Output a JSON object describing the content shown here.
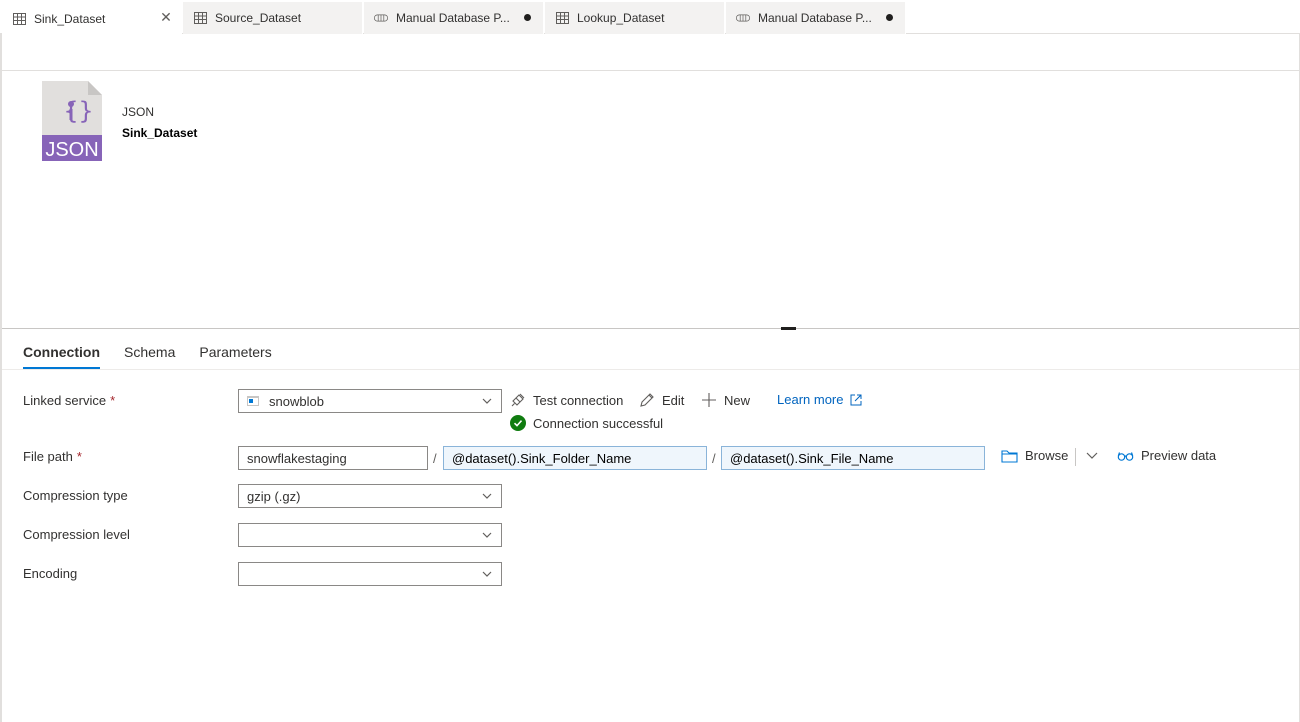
{
  "tabs": [
    {
      "label": "Sink_Dataset",
      "icon": "table-icon",
      "active": true,
      "closable": true
    },
    {
      "label": "Source_Dataset",
      "icon": "table-icon",
      "active": false
    },
    {
      "label": "Manual Database P...",
      "icon": "pipeline-icon",
      "active": false,
      "unsaved": true
    },
    {
      "label": "Lookup_Dataset",
      "icon": "table-icon",
      "active": false
    },
    {
      "label": "Manual Database P...",
      "icon": "pipeline-icon",
      "active": false,
      "unsaved": true
    }
  ],
  "dataset": {
    "icon_text": "JSON",
    "type": "JSON",
    "name": "Sink_Dataset",
    "icon_color": "#8764b8"
  },
  "pivots": [
    "Connection",
    "Schema",
    "Parameters"
  ],
  "form": {
    "linked_service": {
      "label": "Linked service",
      "required_mark": "*",
      "value": "snowblob",
      "test_connection": "Test connection",
      "edit": "Edit",
      "new": "New",
      "learn_more": "Learn more",
      "status": "Connection successful",
      "status_color": "#107c10"
    },
    "file_path": {
      "label": "File path",
      "required_mark": "*",
      "container": "snowflakestaging",
      "separator": "/",
      "directory": "@dataset().Sink_Folder_Name",
      "file": "@dataset().Sink_File_Name",
      "browse": "Browse",
      "preview": "Preview data"
    },
    "compression_type": {
      "label": "Compression type",
      "value": "gzip (.gz)"
    },
    "compression_level": {
      "label": "Compression level",
      "value": ""
    },
    "encoding": {
      "label": "Encoding",
      "value": ""
    }
  },
  "colors": {
    "accent": "#0078d4",
    "link": "#0064bf"
  }
}
